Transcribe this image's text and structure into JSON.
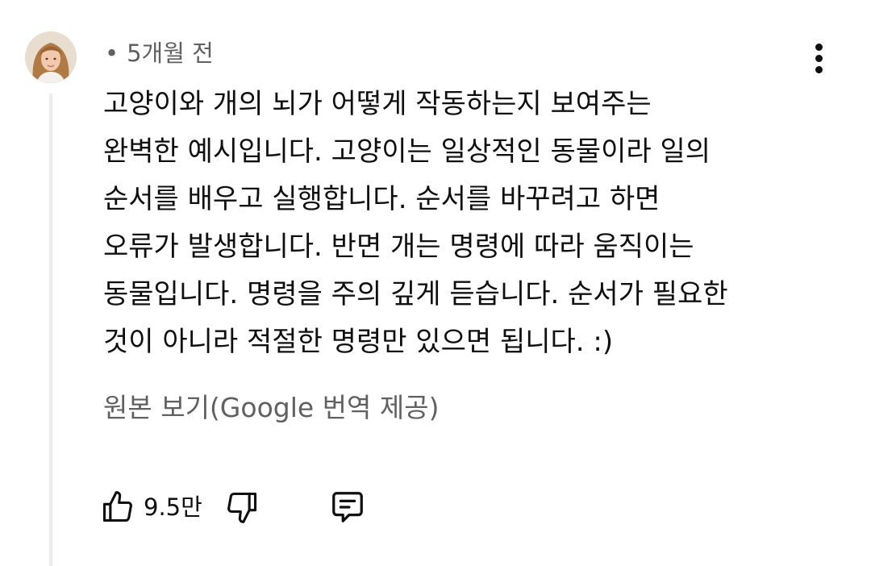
{
  "comment": {
    "avatar_icon": "user-avatar",
    "time_label": "5개월 전",
    "dot": "•",
    "menu_icon": "more-vertical-icon",
    "lines": [
      "고양이와 개의 뇌가 어떻게 작동하는지 보여주는",
      "완벽한 예시입니다. 고양이는 일상적인 동물이라 일의",
      "순서를 배우고 실행합니다. 순서를 바꾸려고 하면",
      "오류가 발생합니다. 반면 개는 명령에 따라 움직이는",
      "동물입니다. 명령을 주의 깊게 듣습니다. 순서가 필요한",
      "것이 아니라 적절한 명령만 있으면 됩니다. :)"
    ],
    "translate_label": "원본 보기(Google 번역 제공)",
    "likes": "9.5만",
    "like_icon": "thumbs-up-icon",
    "dislike_icon": "thumbs-down-icon",
    "reply_icon": "reply-comment-icon"
  },
  "colors": {
    "text": "#0f0f0f",
    "secondary_text": "#606060",
    "thread_line": "#ececec"
  }
}
